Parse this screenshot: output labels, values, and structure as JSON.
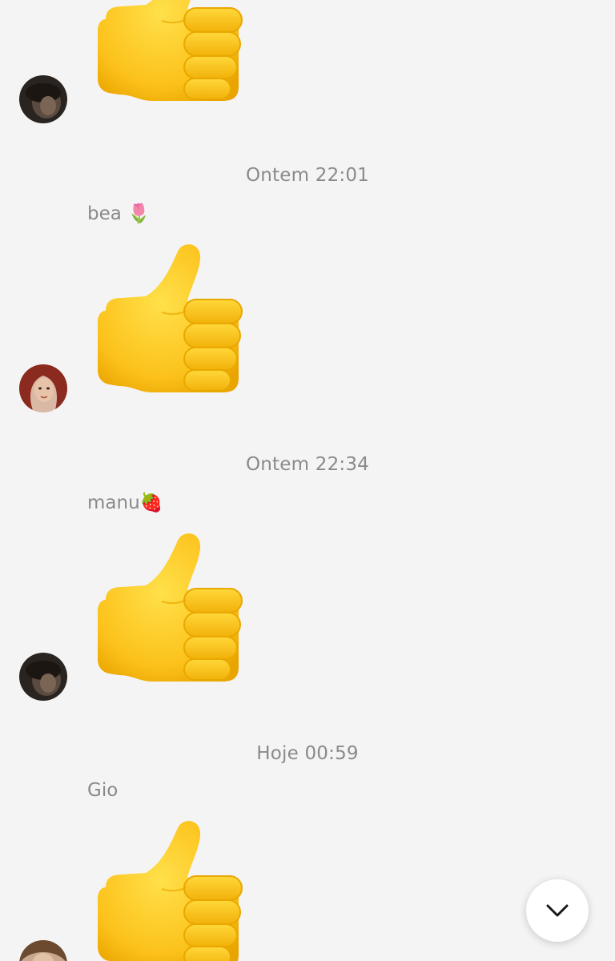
{
  "messages": [
    {
      "timestamp": "",
      "sender": "",
      "avatar": "dark-avatar",
      "content": "👍"
    },
    {
      "timestamp": "Ontem 22:01",
      "sender": "bea 🌷",
      "avatar": "redhead-avatar",
      "content": "👍"
    },
    {
      "timestamp": "Ontem 22:34",
      "sender": "manu🍓",
      "avatar": "dark-avatar",
      "content": "👍"
    },
    {
      "timestamp": "Hoje 00:59",
      "sender": "Gio",
      "avatar": "light-avatar",
      "content": "👍"
    }
  ],
  "icons": {
    "thumbs_up": "thumbs-up-icon",
    "scroll_down": "chevron-down-icon"
  },
  "colors": {
    "background": "#f4f4f4",
    "meta_text": "#8a8a8a",
    "emoji_yellow": "#fcd22d"
  }
}
